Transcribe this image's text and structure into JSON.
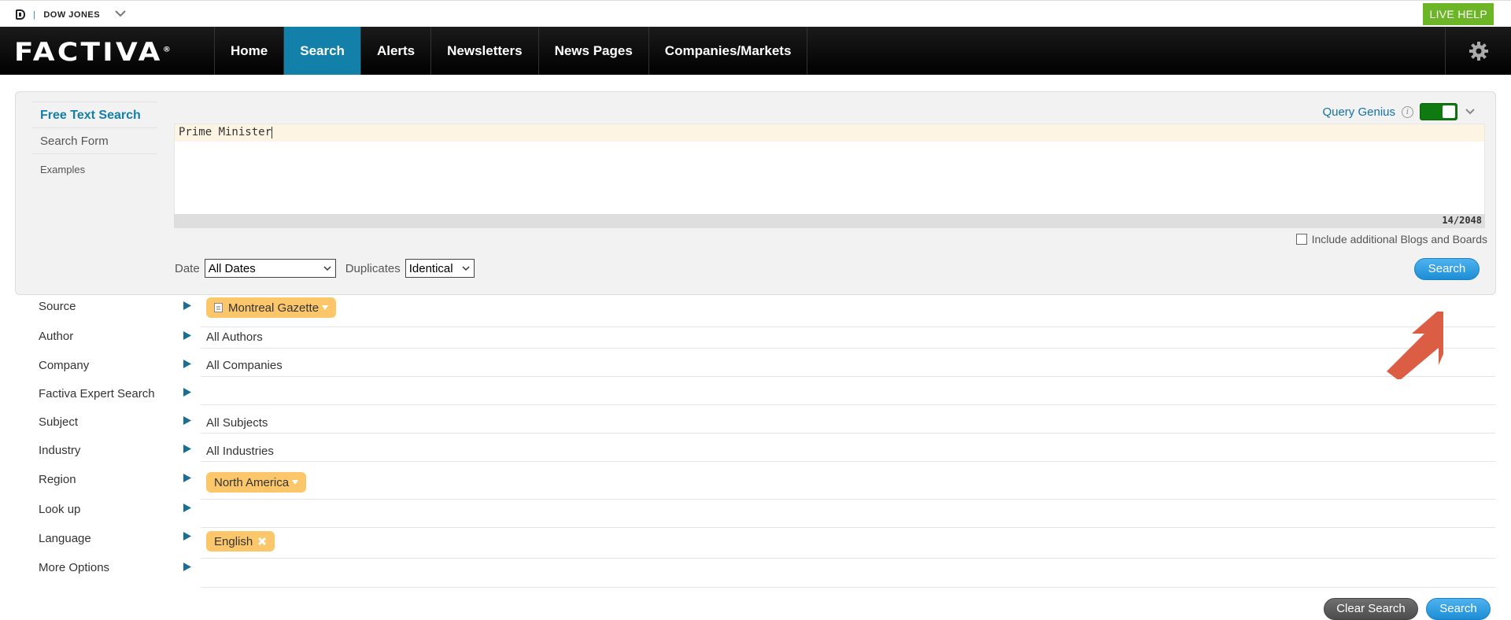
{
  "topbar": {
    "brand": "DOW JONES",
    "live_help": "LIVE HELP"
  },
  "navbar": {
    "logo": "FACTIVA",
    "items": [
      {
        "label": "Home"
      },
      {
        "label": "Search",
        "active": true
      },
      {
        "label": "Alerts"
      },
      {
        "label": "Newsletters"
      },
      {
        "label": "News Pages"
      },
      {
        "label": "Companies/Markets"
      }
    ]
  },
  "panel": {
    "tabs": [
      {
        "label": "Free Text Search",
        "active": true
      },
      {
        "label": "Search Form"
      },
      {
        "label": "Examples"
      }
    ],
    "query_genius_label": "Query Genius",
    "query_genius_on": true,
    "query_text": "Prime Minister",
    "char_counter": "14/2048",
    "blogs_label": "Include additional Blogs and Boards",
    "blogs_checked": false,
    "date_label": "Date",
    "date_value": "All Dates",
    "duplicates_label": "Duplicates",
    "duplicates_value": "Identical",
    "search_label": "Search"
  },
  "criteria": [
    {
      "label": "Source",
      "value": "",
      "pill": "Montreal Gazette",
      "pill_type": "dropdown-doc"
    },
    {
      "label": "Author",
      "value": "All Authors"
    },
    {
      "label": "Company",
      "value": "All Companies"
    },
    {
      "label": "Factiva Expert Search",
      "value": ""
    },
    {
      "label": "Subject",
      "value": "All Subjects"
    },
    {
      "label": "Industry",
      "value": "All Industries"
    },
    {
      "label": "Region",
      "value": "",
      "pill": "North America",
      "pill_type": "dropdown"
    },
    {
      "label": "Look up",
      "value": ""
    },
    {
      "label": "Language",
      "value": "",
      "pill": "English",
      "pill_type": "remove"
    },
    {
      "label": "More Options",
      "value": ""
    }
  ],
  "footer": {
    "clear_label": "Clear Search",
    "search_label": "Search"
  },
  "colors": {
    "accent": "#1280a8",
    "live_help": "#6bb526",
    "pill": "#fcc76a",
    "annotation_arrow": "#d9553a"
  },
  "icons": [
    "dow-jones-logo-icon",
    "chevron-down-icon",
    "gear-icon",
    "info-icon",
    "triangle-right-icon",
    "document-icon",
    "close-icon",
    "annotation-arrow-icon"
  ]
}
